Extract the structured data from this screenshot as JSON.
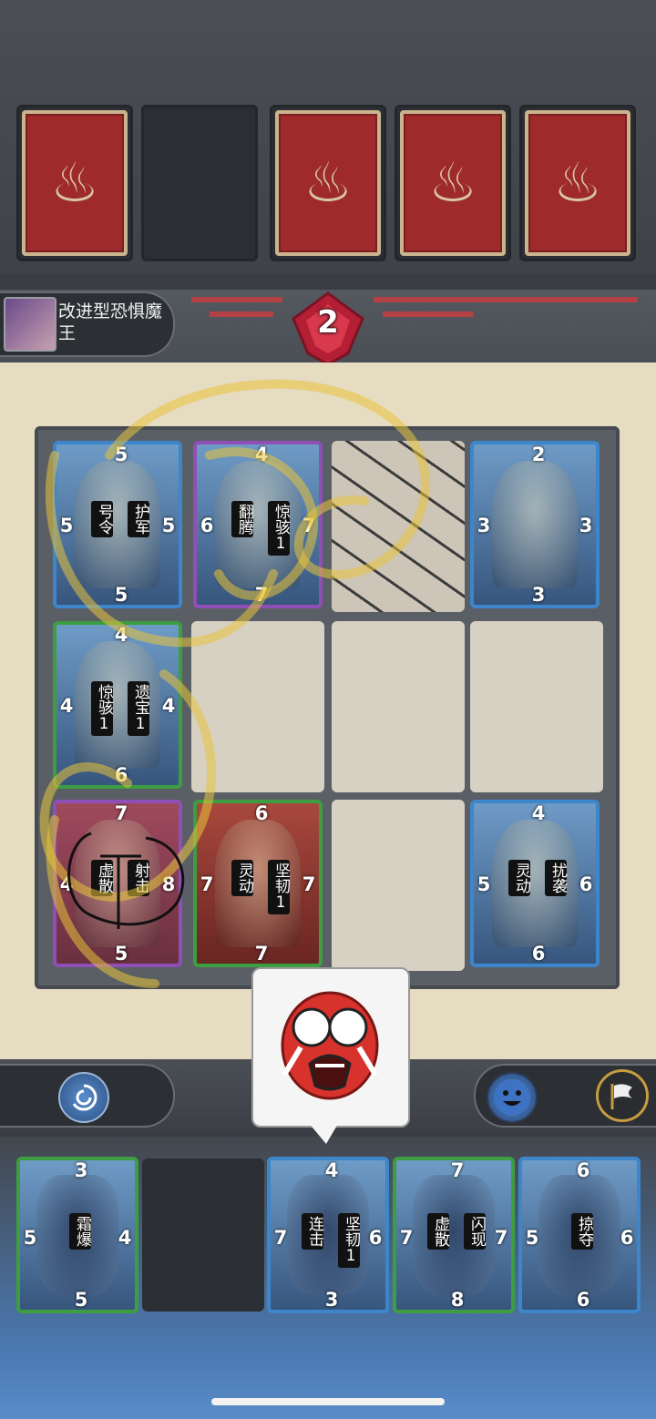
{
  "opponent": {
    "name": "改进型恐惧魔王",
    "score": "2"
  },
  "board": {
    "row1": [
      {
        "top": "5",
        "left": "5",
        "right": "5",
        "bottom": "5",
        "skills": [
          "号令",
          "护军"
        ],
        "frame": "blue"
      },
      {
        "top": "4",
        "left": "6",
        "right": "7",
        "bottom": "7",
        "skills": [
          "翻腾",
          "惊骇1"
        ],
        "frame": "purple"
      },
      null,
      {
        "top": "2",
        "left": "3",
        "right": "3",
        "bottom": "3",
        "skills": [],
        "frame": "blue"
      }
    ],
    "row2": [
      {
        "top": "4",
        "left": "4",
        "right": "4",
        "bottom": "6",
        "skills": [
          "惊骇1",
          "遗宝1"
        ],
        "frame": "green"
      }
    ],
    "row3": [
      {
        "top": "7",
        "left": "4",
        "right": "8",
        "bottom": "5",
        "skills": [
          "虚散",
          "射击"
        ],
        "frame": "purple"
      },
      {
        "top": "6",
        "left": "7",
        "right": "7",
        "bottom": "7",
        "skills": [
          "灵动",
          "坚韧1"
        ],
        "frame": "green"
      },
      null,
      {
        "top": "4",
        "left": "5",
        "right": "6",
        "bottom": "6",
        "skills": [
          "灵动",
          "扰袭"
        ],
        "frame": "blue"
      }
    ]
  },
  "hand": [
    {
      "top": "3",
      "left": "5",
      "right": "4",
      "bottom": "5",
      "skills": [
        "霜爆"
      ],
      "frame": "green"
    },
    {
      "top": "4",
      "left": "7",
      "right": "6",
      "bottom": "3",
      "skills": [
        "连击",
        "坚韧1"
      ],
      "frame": "blue"
    },
    {
      "top": "7",
      "left": "7",
      "right": "7",
      "bottom": "8",
      "skills": [
        "虚散",
        "闪现"
      ],
      "frame": "green"
    },
    {
      "top": "6",
      "left": "5",
      "right": "6",
      "bottom": "6",
      "skills": [
        "掠夺"
      ],
      "frame": "blue"
    }
  ],
  "icons": {
    "opponent_deck": "card-back-emblem",
    "score": "red-gem",
    "left_control": "swirl-icon",
    "emote": "smiley-icon",
    "surrender": "white-flag-icon"
  },
  "colors": {
    "card_back": "#9e2a2b",
    "board": "#e6dcc2",
    "blue_frame": "#3d86cc",
    "green_frame": "#3c9e40",
    "purple_frame": "#8f4fb6"
  }
}
